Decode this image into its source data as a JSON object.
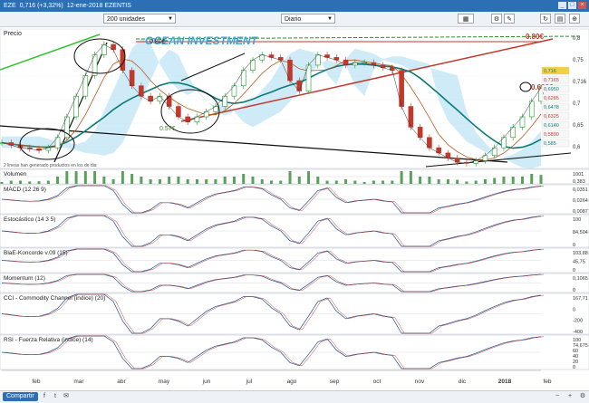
{
  "window": {
    "ticker": "EZE",
    "price": "0,716 (+3,32%)",
    "date": "12-ene-2018 EZENTIS"
  },
  "controls": {
    "units": "200 unidades",
    "period": "Diario"
  },
  "share_label": "Compartir",
  "colors": {
    "accent": "#2d6fb4",
    "price_up": "#1a9a2a",
    "price_down": "#c0392b"
  },
  "price_panel": {
    "title": "Precio",
    "watermark": "OCEAN INVESTMENT",
    "annotation_high": "0.80€",
    "annotation_high_right": "0.80€",
    "annotation_mid": "0.693€",
    "annotation_low": "0.57€",
    "bottom_text": "2 lineas han generado productos en los de dia",
    "axis_ticks": [
      "0,8",
      "0,75",
      "0,716",
      "0,7",
      "0,65",
      "0,6"
    ],
    "right_labels": [
      "0,716",
      "0,7165",
      "0,6950",
      "0,6285",
      "0,6478",
      "0,6325",
      "0,6140",
      "0,5890",
      "0,585"
    ]
  },
  "indicators": [
    {
      "key": "volumen",
      "title": "Volumen",
      "values": [
        "1001",
        "0,383"
      ]
    },
    {
      "key": "macd",
      "title": "MACD (12 26 9)",
      "values": [
        "0,0351",
        "0,0264",
        "0,0087"
      ]
    },
    {
      "key": "stoch",
      "title": "Estocástico (14 3 5)",
      "values": [
        "100",
        "84,504",
        "0"
      ]
    },
    {
      "key": "klinger",
      "title": "BlaE-Koncorde v.09 (15)",
      "values": [
        "103,88",
        "45,75",
        "0"
      ]
    },
    {
      "key": "momentum",
      "title": "Momentum (12)",
      "values": [
        "0,1065",
        "0"
      ]
    },
    {
      "key": "cci",
      "title": "CCI - Commodity Channel (indice) (20)",
      "values": [
        "167,71",
        "0",
        "-200",
        "-400"
      ]
    },
    {
      "key": "rsi",
      "title": "RSI - Fuerza Relativa (indice) (14)",
      "values": [
        "100",
        "74,675",
        "60",
        "40",
        "20",
        "0"
      ]
    }
  ],
  "chart_data": {
    "type": "line",
    "title": "",
    "xlabel": "",
    "ylabel": "",
    "x_ticks": [
      "feb",
      "mar",
      "abr",
      "may",
      "jun",
      "jul",
      "ago",
      "sep",
      "oct",
      "nov",
      "dic",
      "2018",
      "feb"
    ],
    "ylim": [
      0.56,
      0.83
    ],
    "series": [
      {
        "values": [
          0.61,
          0.605,
          0.6,
          0.598,
          0.595,
          0.6,
          0.62,
          0.66,
          0.7,
          0.74,
          0.78,
          0.8,
          0.79,
          0.75,
          0.72,
          0.7,
          0.69,
          0.7,
          0.68,
          0.66,
          0.65,
          0.66,
          0.67,
          0.68,
          0.7,
          0.72,
          0.75,
          0.77,
          0.78,
          0.775,
          0.77,
          0.73,
          0.71,
          0.76,
          0.78,
          0.775,
          0.77,
          0.76,
          0.765,
          0.765,
          0.76,
          0.755,
          0.75,
          0.68,
          0.64,
          0.62,
          0.6,
          0.59,
          0.58,
          0.572,
          0.57,
          0.575,
          0.585,
          0.6,
          0.62,
          0.64,
          0.66,
          0.69,
          0.716
        ]
      }
    ],
    "annotations": [
      "0.80€",
      "0.693€",
      "0.57€"
    ]
  }
}
